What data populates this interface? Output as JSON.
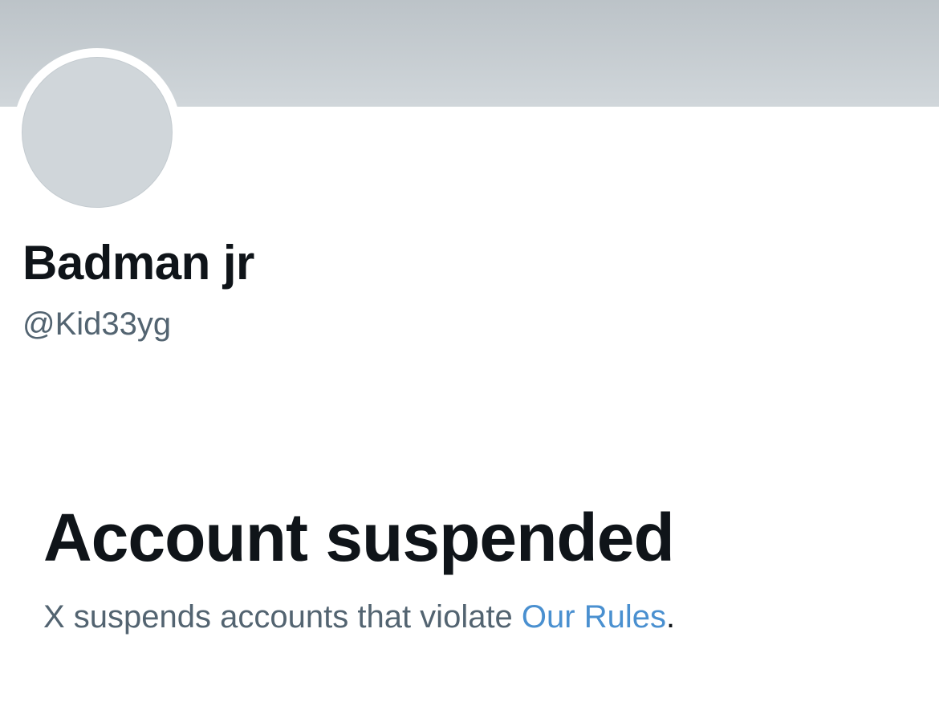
{
  "profile": {
    "display_name": "Badman jr",
    "handle": "@Kid33yg"
  },
  "notice": {
    "title": "Account suspended",
    "message_prefix": "X suspends accounts that violate ",
    "link_label": "Our Rules",
    "message_suffix": "."
  },
  "colors": {
    "banner": "#c4cbd0",
    "avatar_placeholder": "#d0d6da",
    "primary_text": "#0f1419",
    "secondary_text": "#536471",
    "link": "#4a90d0"
  }
}
